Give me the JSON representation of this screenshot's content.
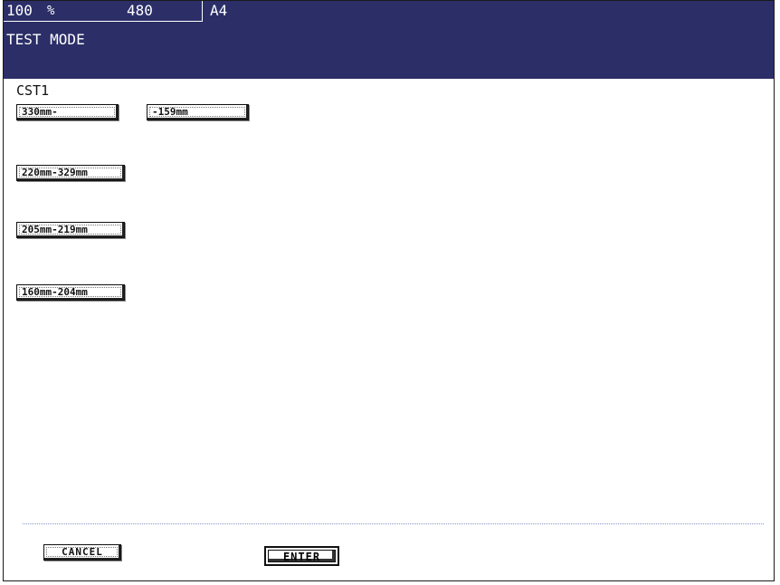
{
  "header": {
    "zoom": "100",
    "zoom_unit": "%",
    "count": "480",
    "paper_size": "A4",
    "mode": "TEST MODE"
  },
  "section": {
    "label": "CST1"
  },
  "range_buttons": [
    "330mm-",
    "-159mm",
    "220mm-329mm",
    "205mm-219mm",
    "160mm-204mm"
  ],
  "footer": {
    "cancel_label": "CANCEL",
    "enter_label": "ENTER"
  },
  "colors": {
    "header_bg": "#2b2e67",
    "divider": "#8892c8"
  }
}
